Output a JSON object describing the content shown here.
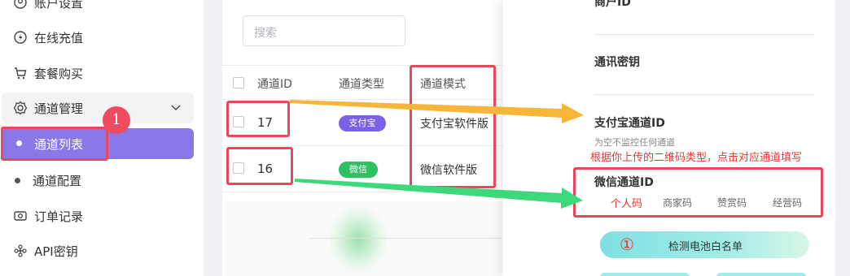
{
  "sidebar": {
    "items": [
      {
        "label": "账户设置",
        "icon": "user-icon"
      },
      {
        "label": "在线充值",
        "icon": "bolt-icon"
      },
      {
        "label": "套餐购买",
        "icon": "cart-icon"
      },
      {
        "label": "通道管理",
        "icon": "gear-icon"
      },
      {
        "label": "通道列表"
      },
      {
        "label": "通道配置"
      },
      {
        "label": "订单记录",
        "icon": "camera-icon"
      },
      {
        "label": "API密钥",
        "icon": "key-icon"
      }
    ]
  },
  "table": {
    "search_placeholder": "搜索",
    "headers": [
      "通道ID",
      "通道类型",
      "通道模式"
    ],
    "rows": [
      {
        "id": "17",
        "type": "支付宝",
        "type_color": "#7b61e8",
        "mode": "支付宝软件版"
      },
      {
        "id": "16",
        "type": "微信",
        "type_color": "#2fc062",
        "mode": "微信软件版"
      }
    ]
  },
  "drawer": {
    "merchant_id_label": "商户ID",
    "secret_label": "通讯密钥",
    "alipay_label": "支付宝通道ID",
    "alipay_hint": "为空不监控任何通道",
    "annotation_note": "根据你上传的二维码类型，点击对应通道填写",
    "wechat_label": "微信通道ID",
    "wechat_options": [
      "个人码",
      "商家码",
      "赞赏码",
      "经营码"
    ],
    "button_label": "检测电池白名单",
    "button_marker": "①"
  },
  "annotation": {
    "badge": "1",
    "colors": {
      "red": "#e8485a",
      "orange": "#f7b63a",
      "green": "#3dd87a"
    }
  }
}
